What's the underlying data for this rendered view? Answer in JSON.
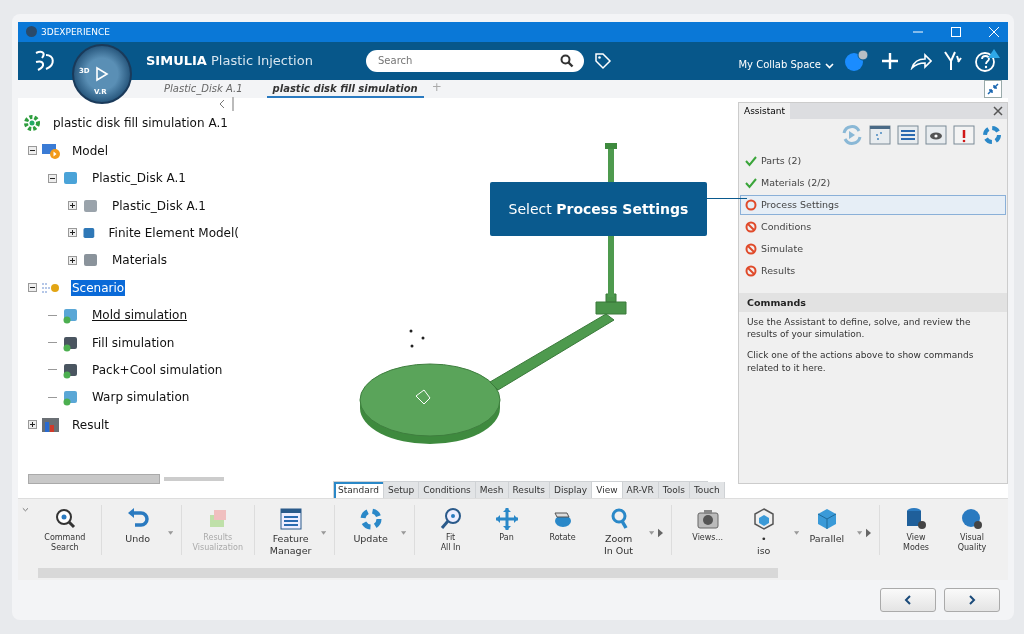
{
  "window": {
    "title": "3DEXPERIENCE"
  },
  "header": {
    "brand": "SIMULIA",
    "app": "Plastic Injection",
    "compass_labels": [
      "3D",
      "V.R"
    ],
    "search": {
      "placeholder": "Search"
    },
    "collab_space": "My Collab Space"
  },
  "doc_tabs": [
    {
      "label": "Plastic_Disk A.1",
      "selected": false
    },
    {
      "label": "plastic disk fill simulation",
      "selected": true
    }
  ],
  "add_tab": "+",
  "tree": {
    "label": "plastic disk fill simulation A.1",
    "kind": "root",
    "selected": false,
    "current": false,
    "children": [
      {
        "label": "Model",
        "kind": "model",
        "expanded": true,
        "selected": false,
        "current": false,
        "children": [
          {
            "label": "Plastic_Disk A.1",
            "kind": "product",
            "expanded": true,
            "selected": false,
            "current": false,
            "children": [
              {
                "label": "Plastic_Disk A.1",
                "kind": "part",
                "expanded": false,
                "selected": false,
                "current": false
              },
              {
                "label": "Finite Element Model(",
                "kind": "fem",
                "expanded": false,
                "selected": false,
                "current": false
              },
              {
                "label": "Materials",
                "kind": "materials",
                "expanded": false,
                "selected": false,
                "current": false
              }
            ]
          }
        ]
      },
      {
        "label": "Scenario",
        "kind": "scenario",
        "expanded": true,
        "selected": true,
        "current": false,
        "children": [
          {
            "label": "Mold simulation",
            "kind": "simulation",
            "selected": false,
            "current": true
          },
          {
            "label": "Fill simulation",
            "kind": "simulation-dark",
            "selected": false,
            "current": false
          },
          {
            "label": "Pack+Cool simulation",
            "kind": "simulation-dark",
            "selected": false,
            "current": false
          },
          {
            "label": "Warp simulation",
            "kind": "simulation",
            "selected": false,
            "current": false
          }
        ]
      },
      {
        "label": "Result",
        "kind": "result",
        "expanded": false,
        "selected": false,
        "current": false
      }
    ]
  },
  "callout": "Select **Process Settings**",
  "assistant": {
    "title": "Assistant",
    "steps": [
      {
        "label": "Parts (2)",
        "kind": "done",
        "selected": false
      },
      {
        "label": "Materials (2/2)",
        "kind": "done",
        "selected": false
      },
      {
        "label": "Process Settings",
        "kind": "current",
        "selected": true
      },
      {
        "label": "Conditions",
        "kind": "blocked",
        "selected": false
      },
      {
        "label": "Simulate",
        "kind": "blocked",
        "selected": false
      },
      {
        "label": "Results",
        "kind": "blocked",
        "selected": false
      }
    ],
    "commands_title": "Commands",
    "paragraphs": [
      "Use the Assistant to define, solve, and review the results of your simulation.",
      "Click one of the actions above to show commands related to it here."
    ]
  },
  "toolbar_tabs": [
    {
      "label": "Standard",
      "selected": true
    },
    {
      "label": "Setup",
      "selected": false
    },
    {
      "label": "Conditions",
      "selected": false
    },
    {
      "label": "Mesh",
      "selected": false
    },
    {
      "label": "Results",
      "selected": false
    },
    {
      "label": "Display",
      "selected": false
    },
    {
      "label": "View",
      "selected": true
    },
    {
      "label": "AR-VR",
      "selected": false
    },
    {
      "label": "Tools",
      "selected": false
    },
    {
      "label": "Touch",
      "selected": false
    }
  ],
  "commands": [
    {
      "lines": [
        "Command",
        "Search"
      ],
      "kind": "search",
      "small": true,
      "disabled": false,
      "dropdown": false,
      "more": false,
      "sep": true
    },
    {
      "lines": [
        "Undo"
      ],
      "kind": "undo",
      "small": false,
      "disabled": false,
      "dropdown": true,
      "more": false,
      "sep": true
    },
    {
      "lines": [
        "Results",
        "Visualization"
      ],
      "kind": "results",
      "small": true,
      "disabled": true,
      "dropdown": false,
      "more": false,
      "sep": true
    },
    {
      "lines": [
        "Feature",
        "Manager"
      ],
      "kind": "feature",
      "small": false,
      "disabled": false,
      "dropdown": true,
      "more": false,
      "sep": true
    },
    {
      "lines": [
        "Update"
      ],
      "kind": "update",
      "small": false,
      "disabled": false,
      "dropdown": true,
      "more": false,
      "sep": true
    },
    {
      "lines": [
        "Fit",
        "All In"
      ],
      "kind": "fit",
      "small": true,
      "disabled": false,
      "dropdown": false,
      "more": false,
      "sep": false
    },
    {
      "lines": [
        "Pan"
      ],
      "kind": "pan",
      "small": true,
      "disabled": false,
      "dropdown": false,
      "more": false,
      "sep": false
    },
    {
      "lines": [
        "Rotate"
      ],
      "kind": "rotate",
      "small": true,
      "disabled": false,
      "dropdown": false,
      "more": false,
      "sep": false
    },
    {
      "lines": [
        "Zoom",
        "In Out"
      ],
      "kind": "zoom",
      "small": false,
      "disabled": false,
      "dropdown": true,
      "more": true,
      "sep": true
    },
    {
      "lines": [
        "Views..."
      ],
      "kind": "camera",
      "small": true,
      "disabled": false,
      "dropdown": false,
      "more": false,
      "sep": false
    },
    {
      "lines": [
        "•",
        "iso"
      ],
      "kind": "iso",
      "small": false,
      "disabled": false,
      "dropdown": true,
      "more": false,
      "sep": false
    },
    {
      "lines": [
        "Parallel"
      ],
      "kind": "cube",
      "small": false,
      "disabled": false,
      "dropdown": true,
      "more": true,
      "sep": true
    },
    {
      "lines": [
        "View",
        "Modes"
      ],
      "kind": "modes",
      "small": true,
      "disabled": false,
      "dropdown": false,
      "more": false,
      "sep": false
    },
    {
      "lines": [
        "Visual",
        "Quality"
      ],
      "kind": "quality",
      "small": true,
      "disabled": false,
      "dropdown": false,
      "more": false,
      "sep": false
    }
  ]
}
